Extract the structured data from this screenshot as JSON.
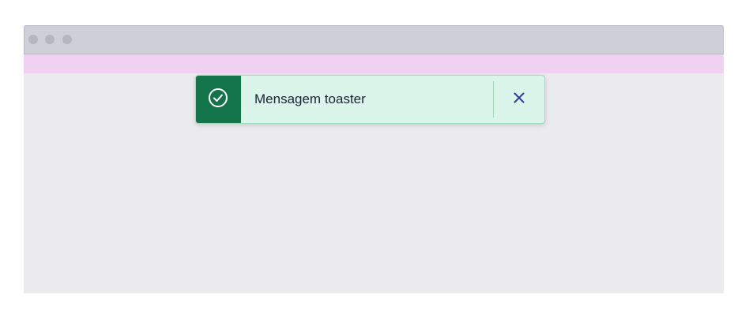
{
  "toaster": {
    "message": "Mensagem toaster",
    "status_icon": "check-circle-icon",
    "close_icon": "close-icon",
    "colors": {
      "icon_background": "#13744a",
      "background": "#dcf5ea",
      "border": "#9fdcc0",
      "close": "#2e3a9e"
    }
  },
  "window": {
    "colors": {
      "titlebar": "#cfcfd7",
      "highlight_band": "#f1d1f1",
      "content": "#ebebed"
    }
  }
}
